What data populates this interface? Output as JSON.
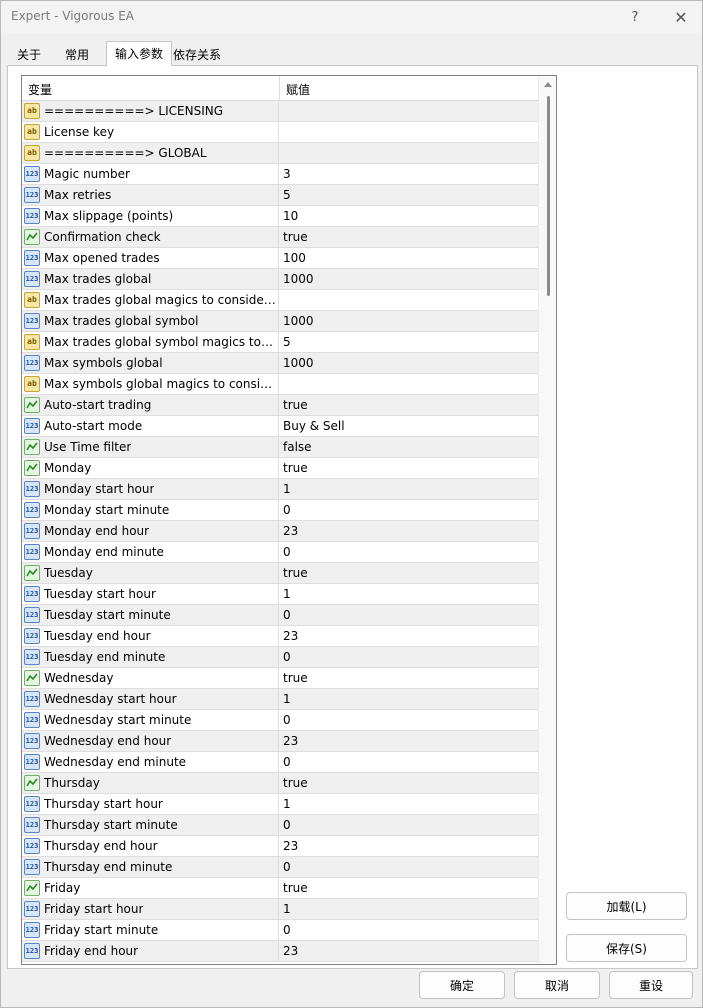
{
  "window": {
    "title": "Expert - Vigorous EA",
    "help_glyph": "?",
    "close_glyph": "✕"
  },
  "tabs": [
    {
      "label": "关于",
      "active": false
    },
    {
      "label": "常用",
      "active": false
    },
    {
      "label": "输入参数",
      "active": true
    },
    {
      "label": "依存关系",
      "active": false
    }
  ],
  "grid": {
    "col_variable": "变量",
    "col_value": "赋值",
    "rows": [
      {
        "type": "ab",
        "name": "==========> LICENSING",
        "value": ""
      },
      {
        "type": "ab",
        "name": "License key",
        "value": ""
      },
      {
        "type": "ab",
        "name": "==========> GLOBAL",
        "value": ""
      },
      {
        "type": "n123",
        "name": "Magic number",
        "value": "3"
      },
      {
        "type": "n123",
        "name": "Max retries",
        "value": "5"
      },
      {
        "type": "n123",
        "name": "Max slippage (points)",
        "value": "10"
      },
      {
        "type": "bool",
        "name": "Confirmation check",
        "value": "true"
      },
      {
        "type": "n123",
        "name": "Max opened trades",
        "value": "100"
      },
      {
        "type": "n123",
        "name": "Max trades global",
        "value": "1000"
      },
      {
        "type": "ab",
        "name": "Max trades global magics to consider...",
        "value": ""
      },
      {
        "type": "n123",
        "name": "Max trades global symbol",
        "value": "1000"
      },
      {
        "type": "ab",
        "name": "Max trades global symbol magics to ...",
        "value": "5"
      },
      {
        "type": "n123",
        "name": "Max symbols global",
        "value": "1000"
      },
      {
        "type": "ab",
        "name": "Max symbols global magics to consid...",
        "value": ""
      },
      {
        "type": "bool",
        "name": "Auto-start trading",
        "value": "true"
      },
      {
        "type": "n123",
        "name": "Auto-start mode",
        "value": "Buy & Sell"
      },
      {
        "type": "bool",
        "name": "Use Time filter",
        "value": "false"
      },
      {
        "type": "bool",
        "name": "Monday",
        "value": "true"
      },
      {
        "type": "n123",
        "name": "Monday start hour",
        "value": "1"
      },
      {
        "type": "n123",
        "name": "Monday start minute",
        "value": "0"
      },
      {
        "type": "n123",
        "name": "Monday end hour",
        "value": "23"
      },
      {
        "type": "n123",
        "name": "Monday end minute",
        "value": "0"
      },
      {
        "type": "bool",
        "name": "Tuesday",
        "value": "true"
      },
      {
        "type": "n123",
        "name": "Tuesday start hour",
        "value": "1"
      },
      {
        "type": "n123",
        "name": "Tuesday start minute",
        "value": "0"
      },
      {
        "type": "n123",
        "name": "Tuesday end hour",
        "value": "23"
      },
      {
        "type": "n123",
        "name": "Tuesday end minute",
        "value": "0"
      },
      {
        "type": "bool",
        "name": "Wednesday",
        "value": "true"
      },
      {
        "type": "n123",
        "name": "Wednesday start hour",
        "value": "1"
      },
      {
        "type": "n123",
        "name": "Wednesday start minute",
        "value": "0"
      },
      {
        "type": "n123",
        "name": "Wednesday end hour",
        "value": "23"
      },
      {
        "type": "n123",
        "name": "Wednesday end minute",
        "value": "0"
      },
      {
        "type": "bool",
        "name": "Thursday",
        "value": "true"
      },
      {
        "type": "n123",
        "name": "Thursday start hour",
        "value": "1"
      },
      {
        "type": "n123",
        "name": "Thursday start minute",
        "value": "0"
      },
      {
        "type": "n123",
        "name": "Thursday end hour",
        "value": "23"
      },
      {
        "type": "n123",
        "name": "Thursday end minute",
        "value": "0"
      },
      {
        "type": "bool",
        "name": "Friday",
        "value": "true"
      },
      {
        "type": "n123",
        "name": "Friday start hour",
        "value": "1"
      },
      {
        "type": "n123",
        "name": "Friday start minute",
        "value": "0"
      },
      {
        "type": "n123",
        "name": "Friday end hour",
        "value": "23"
      }
    ]
  },
  "icons": {
    "ab": {
      "name": "string-type-icon",
      "glyph": "ab"
    },
    "n123": {
      "name": "integer-type-icon",
      "glyph": "123"
    },
    "bool": {
      "name": "boolean-type-icon",
      "glyph": ""
    }
  },
  "buttons": {
    "load": "加载(L)",
    "save": "保存(S)",
    "ok": "确定",
    "cancel": "取消",
    "reset": "重设"
  }
}
